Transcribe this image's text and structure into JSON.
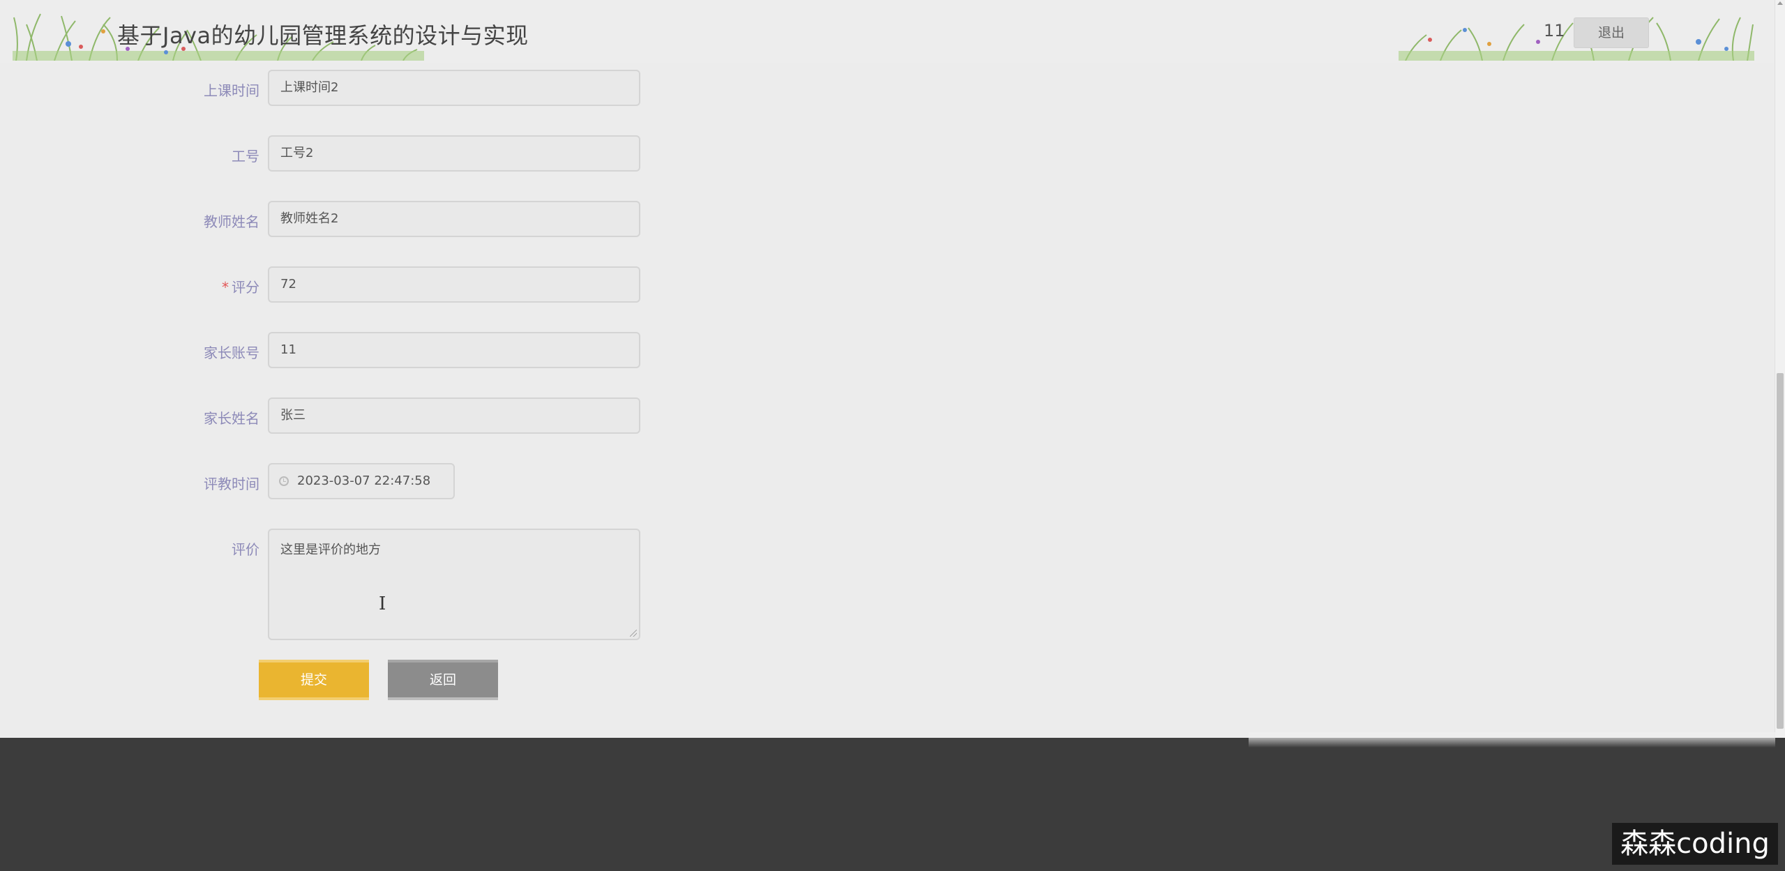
{
  "header": {
    "title": "基于Java的幼儿园管理系统的设计与实现",
    "username": "11",
    "logout_label": "退出"
  },
  "form": {
    "class_time": {
      "label": "上课时间",
      "value": "上课时间2"
    },
    "staff_no": {
      "label": "工号",
      "value": "工号2"
    },
    "teacher_name": {
      "label": "教师姓名",
      "value": "教师姓名2"
    },
    "score": {
      "required_mark": "*",
      "label": "评分",
      "value": "72"
    },
    "parent_account": {
      "label": "家长账号",
      "value": "11"
    },
    "parent_name": {
      "label": "家长姓名",
      "value": "张三"
    },
    "eval_time": {
      "label": "评教时间",
      "value": "2023-03-07 22:47:58"
    },
    "comment": {
      "label": "评价",
      "value": "这里是评价的地方"
    }
  },
  "buttons": {
    "submit_label": "提交",
    "back_label": "返回"
  },
  "watermark": "森森coding",
  "colors": {
    "label": "#8d8ab8",
    "submit": "#eab530",
    "back": "#8c8c8c",
    "background": "#ececec",
    "footer": "#3c3c3c"
  }
}
